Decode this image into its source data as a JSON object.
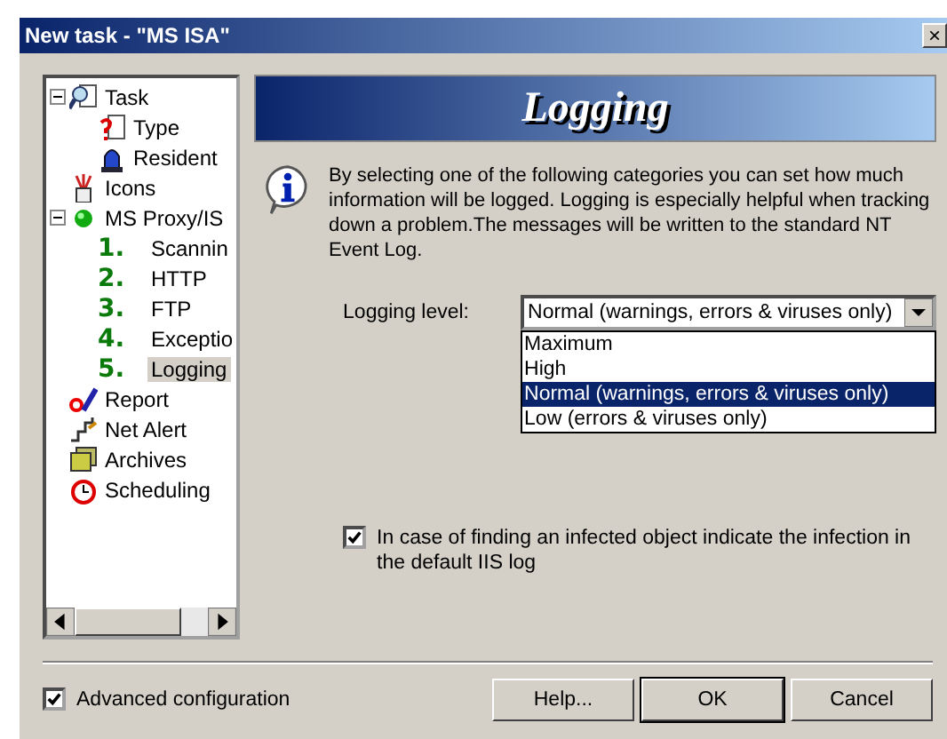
{
  "window": {
    "title": "New task - \"MS ISA\"",
    "close": "×"
  },
  "tree": [
    {
      "label": "Task",
      "kind": "task",
      "expanded": true,
      "selected": false,
      "children": [
        {
          "label": "Type",
          "kind": "type",
          "selected": false
        },
        {
          "label": "Resident",
          "kind": "resident",
          "selected": false
        }
      ]
    },
    {
      "label": "Icons",
      "kind": "icons",
      "selected": false
    },
    {
      "label": "MS Proxy/IS",
      "kind": "proxy",
      "expanded": true,
      "selected": false,
      "children": [
        {
          "label": "Scannin",
          "kind": "step",
          "number": "1.",
          "selected": false
        },
        {
          "label": "HTTP",
          "kind": "step",
          "number": "2.",
          "selected": false
        },
        {
          "label": "FTP",
          "kind": "step",
          "number": "3.",
          "selected": false
        },
        {
          "label": "Exceptio",
          "kind": "step",
          "number": "4.",
          "selected": false
        },
        {
          "label": "Logging",
          "kind": "step",
          "number": "5.",
          "selected": true
        }
      ]
    },
    {
      "label": "Report",
      "kind": "report",
      "selected": false
    },
    {
      "label": "Net Alert",
      "kind": "alert",
      "selected": false
    },
    {
      "label": "Archives",
      "kind": "archives",
      "selected": false
    },
    {
      "label": "Scheduling",
      "kind": "clock",
      "selected": false
    }
  ],
  "banner": {
    "title": "Logging"
  },
  "info": "By selecting one of the following categories you can set how much information will be logged. Logging is especially helpful when tracking down a problem.The messages will be written to the standard NT Event Log.",
  "logging_level": {
    "label": "Logging level:",
    "value": "Normal (warnings, errors & viruses only)",
    "options": [
      {
        "label": "Maximum",
        "selected": false
      },
      {
        "label": "High",
        "selected": false
      },
      {
        "label": "Normal (warnings, errors & viruses only)",
        "selected": true
      },
      {
        "label": "Low (errors & viruses only)",
        "selected": false
      }
    ]
  },
  "iis_log": {
    "label": "In case of finding an infected object indicate the infection in the default IIS log",
    "checked": true
  },
  "advanced": {
    "label": "Advanced configuration",
    "checked": true
  },
  "buttons": [
    "Help...",
    "OK",
    "Cancel"
  ]
}
